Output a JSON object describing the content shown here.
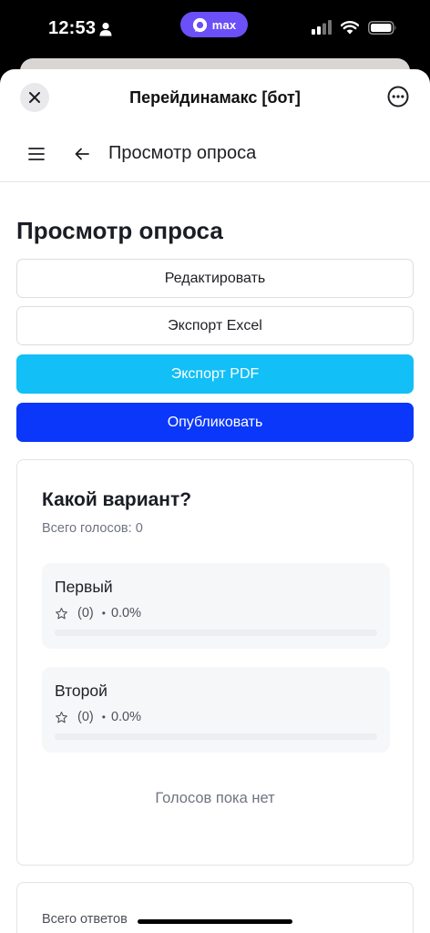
{
  "status_bar": {
    "time": "12:53",
    "app_pill": "max"
  },
  "sheet": {
    "title": "Перейдинамакс [бот]"
  },
  "nav": {
    "title": "Просмотр опроса"
  },
  "page": {
    "title": "Просмотр опроса",
    "buttons": {
      "edit": "Редактировать",
      "export_excel": "Экспорт Excel",
      "export_pdf": "Экспорт PDF",
      "publish": "Опубликовать"
    }
  },
  "poll": {
    "question": "Какой вариант?",
    "total_votes": "Всего голосов: 0",
    "options": [
      {
        "name": "Первый",
        "count": "(0)",
        "percent": "0.0%",
        "fill": 0
      },
      {
        "name": "Второй",
        "count": "(0)",
        "percent": "0.0%",
        "fill": 0
      }
    ],
    "empty_message": "Голосов пока нет"
  },
  "answers": {
    "label": "Всего ответов"
  },
  "colors": {
    "pill": "#6b4ff7",
    "pdf_button": "#12bff6",
    "publish_button": "#0a37fa"
  },
  "icons": {
    "close": "close-icon",
    "more": "more-icon",
    "menu": "menu-icon",
    "back": "arrow-left-icon",
    "star": "star-outline-icon"
  }
}
